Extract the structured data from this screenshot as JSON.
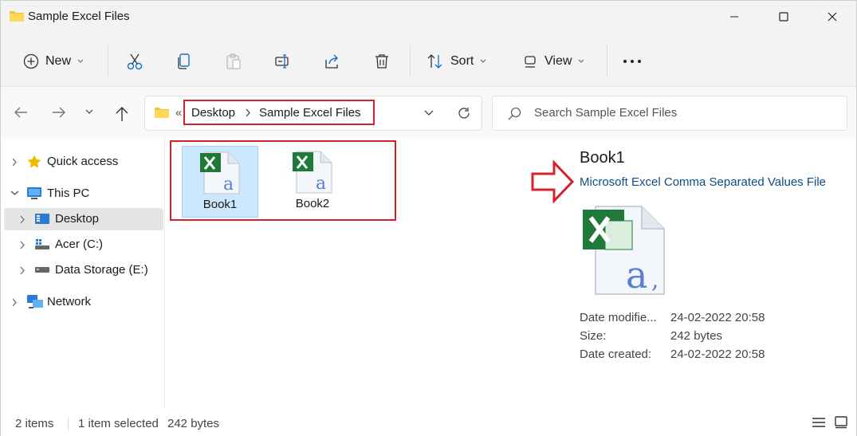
{
  "window": {
    "title": "Sample Excel Files"
  },
  "toolbar": {
    "new_label": "New",
    "sort_label": "Sort",
    "view_label": "View"
  },
  "nav": {
    "breadcrumb": [
      "Desktop",
      "Sample Excel Files"
    ],
    "overflow": "«",
    "search_placeholder": "Search Sample Excel Files"
  },
  "sidebar": {
    "items": [
      {
        "label": "Quick access"
      },
      {
        "label": "This PC"
      },
      {
        "label": "Desktop"
      },
      {
        "label": "Acer (C:)"
      },
      {
        "label": "Data Storage (E:)"
      },
      {
        "label": "Network"
      }
    ]
  },
  "files": [
    {
      "name": "Book1",
      "selected": true
    },
    {
      "name": "Book2",
      "selected": false
    }
  ],
  "details": {
    "name": "Book1",
    "type": "Microsoft Excel Comma Separated Values File",
    "rows": [
      {
        "key": "Date modifie...",
        "value": "24-02-2022 20:58"
      },
      {
        "key": "Size:",
        "value": "242 bytes"
      },
      {
        "key": "Date created:",
        "value": "24-02-2022 20:58"
      }
    ]
  },
  "status": {
    "items": "2 items",
    "selection": "1 item selected",
    "size": "242 bytes"
  },
  "colors": {
    "highlight_red": "#d6202e",
    "selection_blue": "#cce8ff",
    "excel_green": "#1f7a3a"
  }
}
